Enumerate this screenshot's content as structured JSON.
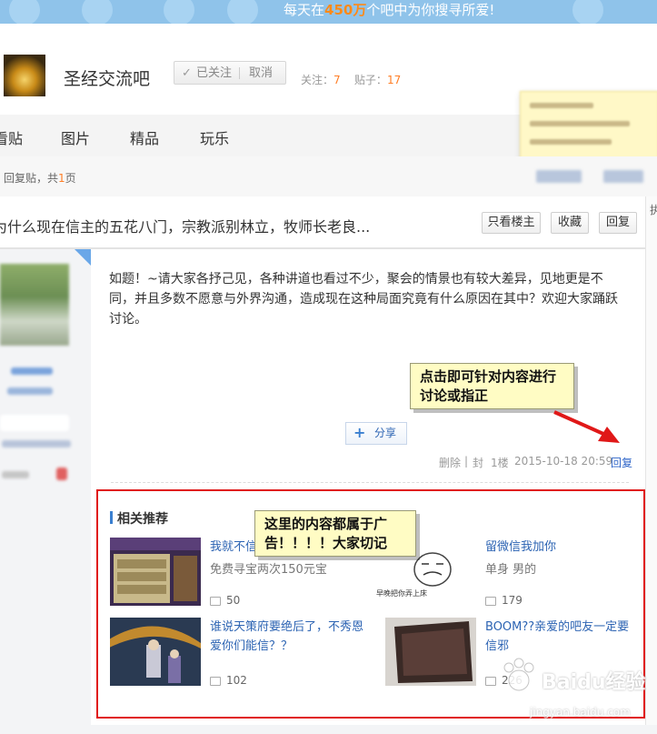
{
  "banner": {
    "text_before": "每天在",
    "text_highlight": "450万",
    "text_after": "个吧中为你搜寻所爱!"
  },
  "header": {
    "forum_name": "圣经交流吧",
    "follow_label": "已关注",
    "cancel_label": "取消",
    "follow_count_label": "关注：",
    "follow_count": "7",
    "post_count_label": "贴子：",
    "post_count": "17"
  },
  "nav": {
    "tabs": [
      "看贴",
      "图片",
      "精品",
      "玩乐"
    ]
  },
  "pager": {
    "prefix": "回复贴，共",
    "pages": "1",
    "suffix": "页"
  },
  "right_column": {
    "label": "执"
  },
  "post": {
    "title": "为什么现在信主的五花八门，宗教派别林立，牧师长老良...",
    "buttons": {
      "only_op": "只看楼主",
      "favorite": "收藏",
      "reply": "回复"
    },
    "content": "如题！~请大家各抒己见，各种讲道也看过不少，聚会的情景也有较大差异，见地更是不同，并且多数不愿意与外界沟通，造成现在这种局面究竟有什么原因在其中？欢迎大家踊跃讨论。",
    "share_label": "分享",
    "meta": {
      "delete": "删除",
      "sep": "|",
      "block": "封",
      "floor": "1楼",
      "time": "2015-10-18 20:59"
    },
    "reply_link": "回复"
  },
  "callouts": {
    "reply_tip": "点击即可针对内容进行讨论或指正",
    "ad_tip": "这里的内容都属于广告！！！！大家切记"
  },
  "related": {
    "heading": "相关推荐",
    "items": [
      {
        "title": "我就不信",
        "subtitle": "免费寻宝两次150元宝",
        "comments": "50"
      },
      {
        "title": "留微信我加你",
        "subtitle": "单身 男的",
        "comments": "179",
        "image_caption": "早晚把你弄上床"
      },
      {
        "title": "谁说天策府要绝后了，不秀恩爱你们能信？？",
        "subtitle": "",
        "comments": "102"
      },
      {
        "title": "BOOM??亲爱的吧友一定要信邪",
        "subtitle": "",
        "comments": "226"
      }
    ]
  },
  "watermark": {
    "brand": "Baidu经验",
    "url": "jingyan.baidu.com"
  },
  "colors": {
    "accent": "#ff7e26",
    "link": "#2d64b3",
    "highlight_box": "#e01818",
    "callout_bg": "#fffcc4"
  }
}
